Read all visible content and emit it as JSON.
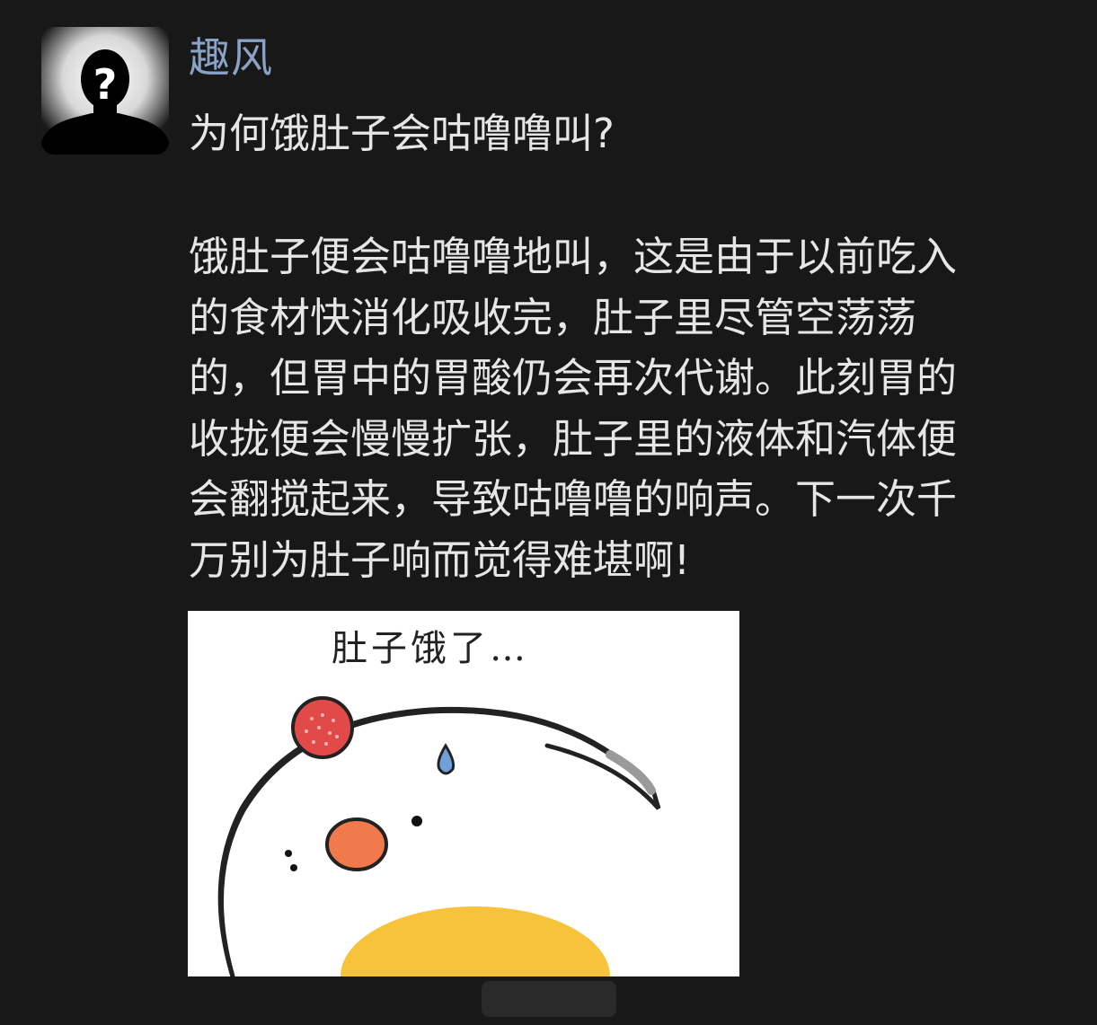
{
  "post": {
    "author": "趣风",
    "title": "为何饿肚子会咕噜噜叫?",
    "body_lines": [
      "饿肚子便会咕噜噜地叫，这是由于以前吃入",
      "的食材快消化吸收完，肚子里尽管空荡荡",
      "的，但胃中的胃酸仍会再次代谢。此刻胃的",
      "收拢便会慢慢扩张，肚子里的液体和汽体便",
      "会翻搅起来，导致咕噜噜的响声。下一次千",
      "万别为肚子响而觉得难堪啊!"
    ]
  },
  "meme": {
    "caption": "肚子饿了…"
  },
  "icons": {
    "avatar": "anonymous-user-question-mark-icon"
  },
  "colors": {
    "background": "#181818",
    "author": "#8aa2c6",
    "text": "#e6e6e6"
  }
}
